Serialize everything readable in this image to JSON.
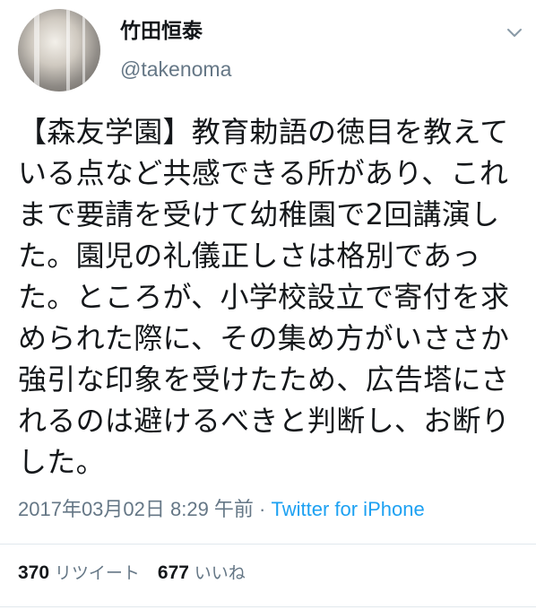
{
  "author": {
    "display_name": "竹田恒泰",
    "handle": "@takenoma"
  },
  "icons": {
    "avatar": "profile-photo",
    "caret": "chevron-down-icon"
  },
  "tweet": {
    "text": "【森友学園】教育勅語の徳目を教えている点など共感できる所があり、これまで要請を受けて幼稚園で2回講演した。園児の礼儀正しさは格別であった。ところが、小学校設立で寄付を求められた際に、その集め方がいささか強引な印象を受けたため、広告塔にされるのは避けるべきと判断し、お断りした。",
    "timestamp": "2017年03月02日 8:29 午前",
    "separator": " · ",
    "source": "Twitter for iPhone"
  },
  "stats": {
    "retweets_count": "370",
    "retweets_label": "リツイート",
    "likes_count": "677",
    "likes_label": "いいね"
  },
  "colors": {
    "text": "#14171a",
    "secondary": "#657786",
    "link": "#1da1f2",
    "divider": "#e1e8ed"
  }
}
